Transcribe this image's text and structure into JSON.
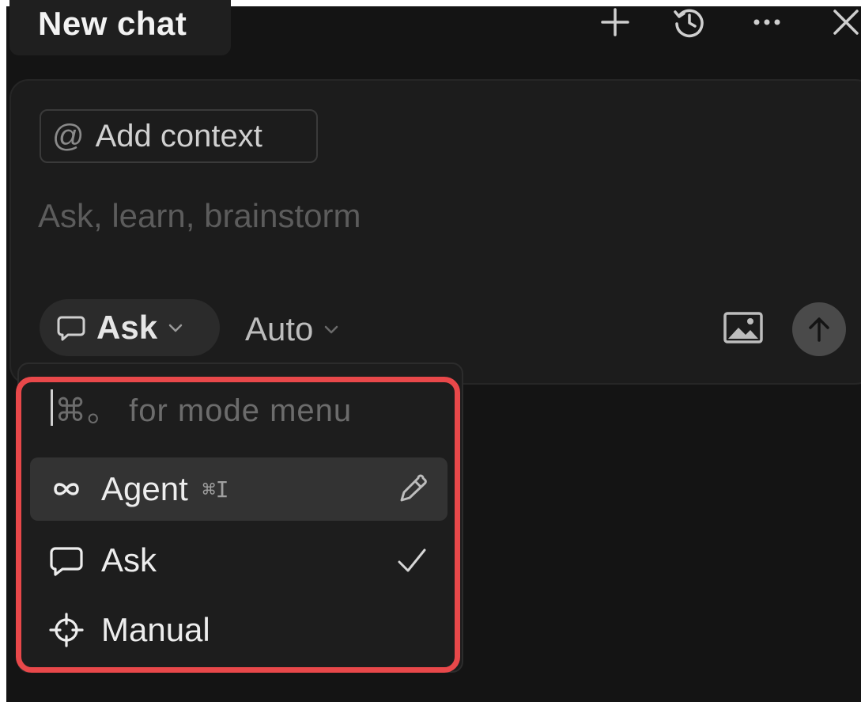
{
  "header": {
    "title": "New chat",
    "icons": [
      "plus-icon",
      "history-icon",
      "more-icon",
      "close-icon"
    ]
  },
  "composer": {
    "context_button": {
      "at": "@",
      "label": "Add context"
    },
    "placeholder": "Ask, learn, brainstorm",
    "mode": {
      "label": "Ask",
      "icon": "chat-bubble-icon"
    },
    "model": {
      "label": "Auto"
    },
    "icons": [
      "image-icon",
      "arrow-up-icon"
    ]
  },
  "mode_menu": {
    "search_hint": "⌘。 for mode menu",
    "items": [
      {
        "label": "Agent",
        "shortcut": "⌘I",
        "icon": "infinity-icon",
        "trailing": "pencil-icon",
        "highlighted": true
      },
      {
        "label": "Ask",
        "shortcut": "",
        "icon": "chat-bubble-icon",
        "trailing": "check-icon",
        "selected": true
      },
      {
        "label": "Manual",
        "shortcut": "",
        "icon": "crosshair-icon",
        "trailing": ""
      }
    ],
    "highlight_color": "#e8484a"
  },
  "colors": {
    "background": "#141414",
    "surface": "#1c1c1c",
    "accent": "#e8484a"
  }
}
